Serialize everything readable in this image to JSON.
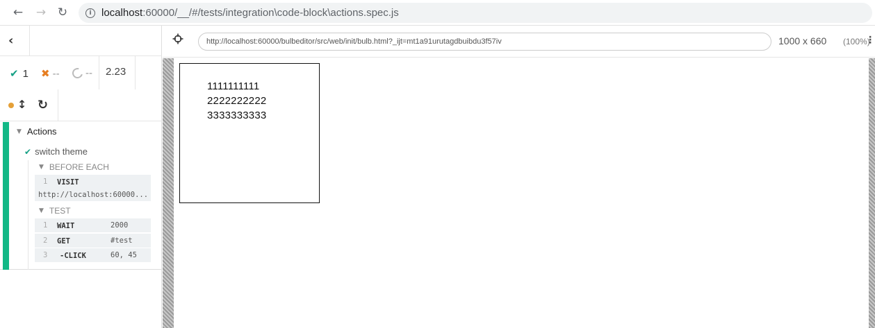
{
  "browser": {
    "back_icon": "arrow-left-icon",
    "forward_icon": "arrow-right-icon",
    "reload_icon": "reload-icon",
    "url_host": "localhost",
    "url_rest": ":60000/__/#/tests/integration\\code-block\\actions.spec.js"
  },
  "reporter": {
    "stats": {
      "passed": "1",
      "failed": "--",
      "pending": "--",
      "duration": "2.23"
    },
    "suite": {
      "title": "Actions",
      "test": {
        "title": "switch theme",
        "before_each_label": "BEFORE EACH",
        "test_label": "TEST",
        "before_each_commands": [
          {
            "num": "1",
            "name": "VISIT",
            "message": "http://localhost:60000..."
          }
        ],
        "test_commands": [
          {
            "num": "1",
            "name": "WAIT",
            "message": "2000"
          },
          {
            "num": "2",
            "name": "GET",
            "message": "#test"
          },
          {
            "num": "3",
            "name": "-CLICK",
            "message": "60, 45"
          }
        ]
      }
    },
    "colors": {
      "pass": "#12b886",
      "fail": "#e67e22",
      "running": "#e5a038"
    }
  },
  "preview": {
    "aut_url": "http://localhost:60000/bulbeditor/src/web/init/bulb.html?_ijt=mt1a91urutagdbuibdu3f57iv",
    "viewport_size": "1000 x 660",
    "viewport_pct": "(100%)",
    "code_lines": [
      "1111111111",
      "2222222222",
      "3333333333"
    ]
  }
}
